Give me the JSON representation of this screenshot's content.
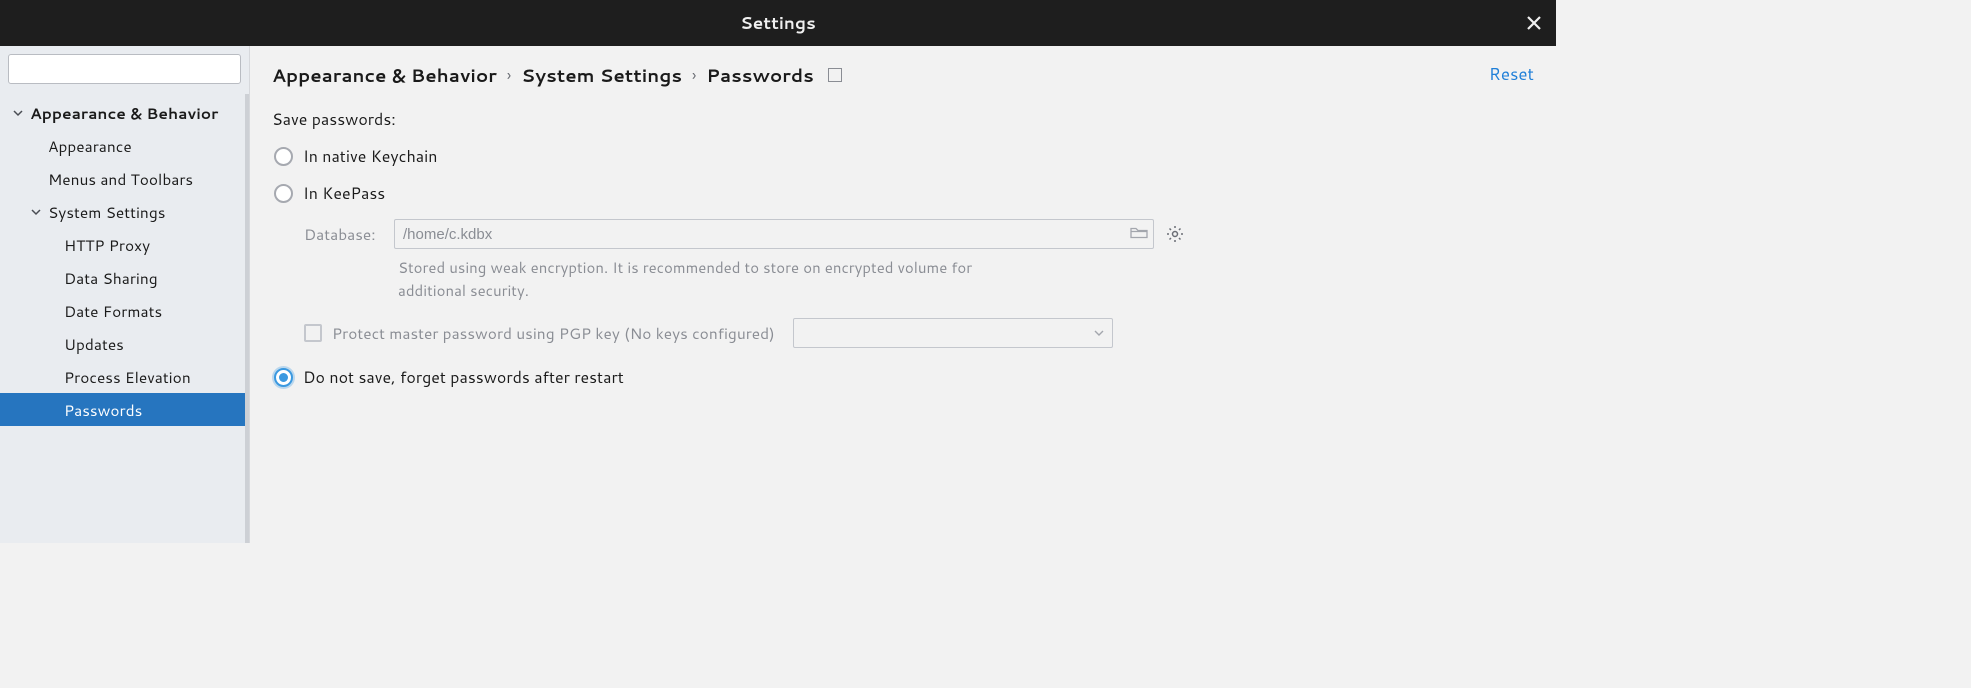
{
  "window": {
    "title": "Settings"
  },
  "sidebar": {
    "search_placeholder": "",
    "items": [
      {
        "label": "Appearance & Behavior",
        "level": 0,
        "expanded": true
      },
      {
        "label": "Appearance",
        "level": 1
      },
      {
        "label": "Menus and Toolbars",
        "level": 1
      },
      {
        "label": "System Settings",
        "level": 1,
        "expanded": true,
        "has_children": true
      },
      {
        "label": "HTTP Proxy",
        "level": 2
      },
      {
        "label": "Data Sharing",
        "level": 2
      },
      {
        "label": "Date Formats",
        "level": 2
      },
      {
        "label": "Updates",
        "level": 2
      },
      {
        "label": "Process Elevation",
        "level": 2
      },
      {
        "label": "Passwords",
        "level": 2,
        "selected": true
      }
    ]
  },
  "breadcrumb": {
    "part1": "Appearance & Behavior",
    "part2": "System Settings",
    "part3": "Passwords"
  },
  "actions": {
    "reset": "Reset"
  },
  "form": {
    "section_label": "Save passwords:",
    "option_native": "In native Keychain",
    "option_keepass": "In KeePass",
    "database_label": "Database:",
    "database_value": "/home/c.kdbx",
    "encryption_hint": "Stored using weak encryption. It is recommended to store on encrypted volume for additional security.",
    "pgp_checkbox": "Protect master password using PGP key (No keys configured)",
    "option_donotsave": "Do not save, forget passwords after restart",
    "selected_option": "donotsave"
  }
}
